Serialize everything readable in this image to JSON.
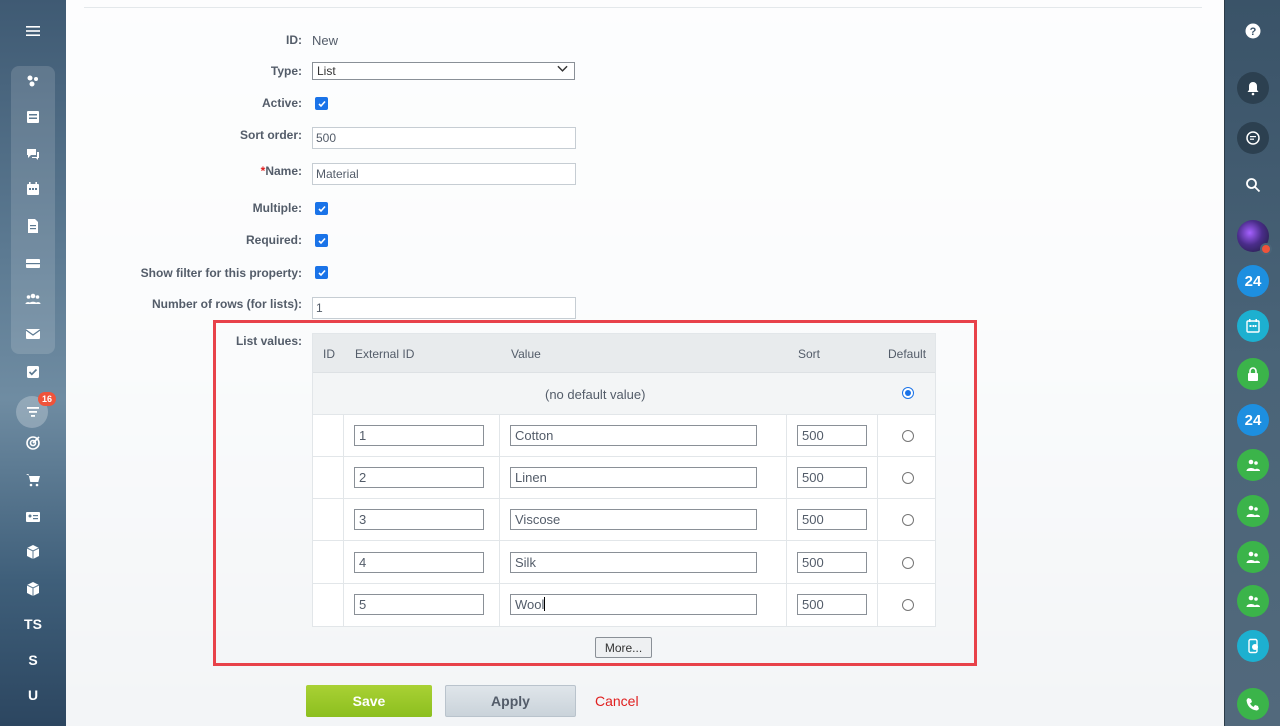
{
  "left_sidebar": {
    "menu_icon": "hamburger-icon",
    "badge_count": "16",
    "items": [
      {
        "icon": "feed-icon",
        "label": ""
      },
      {
        "icon": "tasks-icon",
        "label": ""
      },
      {
        "icon": "chat-icon",
        "label": ""
      },
      {
        "icon": "calendar-icon",
        "label": ""
      },
      {
        "icon": "document-icon",
        "label": ""
      },
      {
        "icon": "drive-icon",
        "label": ""
      },
      {
        "icon": "employees-icon",
        "label": ""
      },
      {
        "icon": "mail-icon",
        "label": ""
      },
      {
        "icon": "checklist-icon",
        "label": ""
      },
      {
        "icon": "filter-icon",
        "label": ""
      },
      {
        "icon": "target-icon",
        "label": ""
      },
      {
        "icon": "cart-icon",
        "label": ""
      },
      {
        "icon": "contact-card-icon",
        "label": ""
      },
      {
        "icon": "box-icon",
        "label": ""
      },
      {
        "icon": "box-icon",
        "label": ""
      },
      {
        "icon": "text",
        "label": "TS"
      },
      {
        "icon": "text",
        "label": "S"
      },
      {
        "icon": "text",
        "label": "U"
      }
    ]
  },
  "right_sidebar": {
    "items": [
      {
        "icon": "help-icon",
        "label": "?"
      },
      {
        "icon": "bell-icon",
        "label": ""
      },
      {
        "icon": "chat-bubble-icon",
        "label": ""
      },
      {
        "icon": "search-icon",
        "label": ""
      },
      {
        "icon": "avatar-icon",
        "label": ""
      },
      {
        "icon": "bitrix24-icon",
        "label": "24"
      },
      {
        "icon": "calendar-icon",
        "label": ""
      },
      {
        "icon": "lock-icon",
        "label": ""
      },
      {
        "icon": "bitrix24-icon",
        "label": "24"
      },
      {
        "icon": "group-icon",
        "label": ""
      },
      {
        "icon": "group-icon",
        "label": ""
      },
      {
        "icon": "group-icon",
        "label": ""
      },
      {
        "icon": "group-icon",
        "label": ""
      },
      {
        "icon": "phone-chat-icon",
        "label": ""
      },
      {
        "icon": "phone-icon",
        "label": ""
      }
    ]
  },
  "form": {
    "id": {
      "label": "ID:",
      "value": "New"
    },
    "type": {
      "label": "Type:",
      "value": "List"
    },
    "active": {
      "label": "Active:",
      "checked": true
    },
    "sort_order": {
      "label": "Sort order:",
      "value": "500"
    },
    "name": {
      "required_mark": "*",
      "label": "Name:",
      "value": "Material"
    },
    "multiple": {
      "label": "Multiple:",
      "checked": true
    },
    "required": {
      "label": "Required:",
      "checked": true
    },
    "show_filter": {
      "label": "Show filter for this property:",
      "checked": true
    },
    "rows": {
      "label": "Number of rows (for lists):",
      "value": "1"
    },
    "list_values_label": "List values:"
  },
  "list_table": {
    "headers": {
      "id": "ID",
      "external_id": "External ID",
      "value": "Value",
      "sort": "Sort",
      "default": "Default"
    },
    "no_default": "(no default value)",
    "rows": [
      {
        "external_id": "1",
        "value": "Cotton",
        "sort": "500"
      },
      {
        "external_id": "2",
        "value": "Linen",
        "sort": "500"
      },
      {
        "external_id": "3",
        "value": "Viscose",
        "sort": "500"
      },
      {
        "external_id": "4",
        "value": "Silk",
        "sort": "500"
      },
      {
        "external_id": "5",
        "value": "Wool",
        "sort": "500"
      }
    ],
    "more_label": "More..."
  },
  "buttons": {
    "save": "Save",
    "apply": "Apply",
    "cancel": "Cancel"
  },
  "colors": {
    "highlight": "#e8424a",
    "save": "#8cbf1f",
    "checkbox": "#1a73e8",
    "cancel": "#e02020"
  }
}
